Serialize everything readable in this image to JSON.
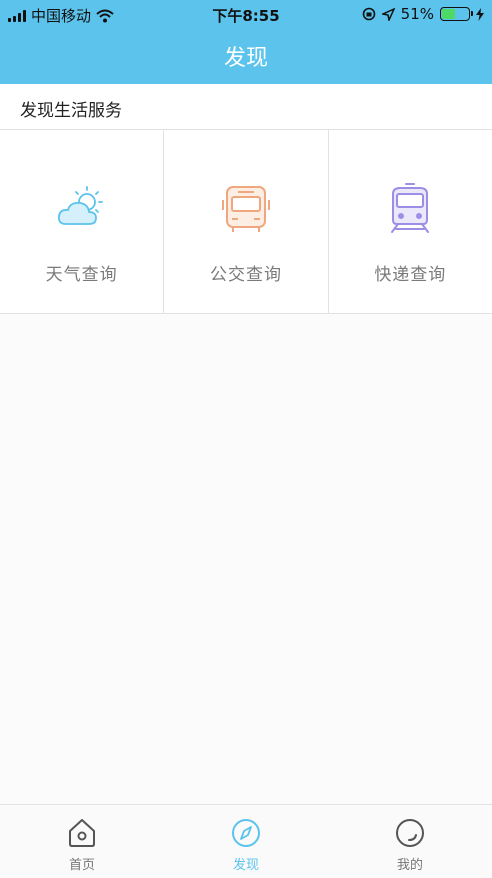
{
  "status_bar": {
    "carrier": "中国移动",
    "time": "下午8:55",
    "battery_percent": "51%"
  },
  "nav": {
    "title": "发现"
  },
  "section": {
    "title": "发现生活服务"
  },
  "services": [
    {
      "label": "天气查询",
      "icon": "weather-icon"
    },
    {
      "label": "公交查询",
      "icon": "bus-icon"
    },
    {
      "label": "快递查询",
      "icon": "train-icon"
    }
  ],
  "tabs": [
    {
      "label": "首页",
      "icon": "home-icon",
      "active": false
    },
    {
      "label": "发现",
      "icon": "compass-icon",
      "active": true
    },
    {
      "label": "我的",
      "icon": "profile-icon",
      "active": false
    }
  ],
  "colors": {
    "header": "#5bc3ec",
    "active_tab": "#5bc3ec",
    "weather_icon": "#5bc3ec",
    "bus_icon": "#f0a77f",
    "train_icon": "#9b8ee6"
  }
}
